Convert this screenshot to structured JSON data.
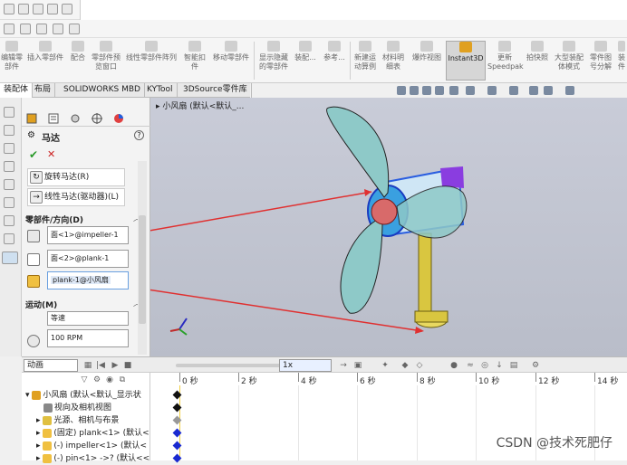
{
  "command_manager": {
    "buttons": [
      {
        "label": "编辑零\n部件"
      },
      {
        "label": "插入零部件"
      },
      {
        "label": "配合"
      },
      {
        "label": "零部件预\n览窗口"
      },
      {
        "label": "线性零部件阵列"
      },
      {
        "label": "智能扣\n件"
      },
      {
        "label": "移动零部件"
      },
      {
        "label": "显示隐藏\n的零部件"
      },
      {
        "label": "装配..."
      },
      {
        "label": "参考..."
      },
      {
        "label": "新建运\n动算例"
      },
      {
        "label": "材料明\n细表"
      },
      {
        "label": "爆炸视图"
      },
      {
        "label": "Instant3D"
      },
      {
        "label": "更新\nSpeedpak"
      },
      {
        "label": "拍快照"
      },
      {
        "label": "大型装配\n体模式"
      },
      {
        "label": "零件图\n号分解"
      },
      {
        "label": "装\n件"
      }
    ]
  },
  "tabs": [
    "装配体",
    "布局",
    "SOLIDWORKS MBD",
    "KYTool",
    "3DSource零件库"
  ],
  "viewport": {
    "tree_header": "小风扇 (默认<默认_..."
  },
  "property_manager": {
    "title": "马达",
    "help": "?",
    "ok": "✔",
    "cancel": "✕",
    "motor_types": [
      {
        "label": "旋转马达(R)"
      },
      {
        "label": "线性马达(驱动器)(L)"
      }
    ],
    "section_component": "零部件/方向(D)",
    "face1": "面<1>@impeller-1",
    "face2": "面<2>@plank-1",
    "ref": "plank-1@小风扇",
    "section_motion": "运动(M)",
    "motion_type": "等速",
    "speed": "100 RPM"
  },
  "motion_bar": {
    "study_type": "动画",
    "speed_multiplier": "1x"
  },
  "timeline": {
    "ticks": [
      "0 秒",
      "2 秒",
      "4 秒",
      "6 秒",
      "8 秒",
      "10 秒",
      "12 秒",
      "14 秒"
    ],
    "tree": [
      {
        "label": "小风扇 (默认<默认_显示状"
      },
      {
        "label": "视向及相机视图"
      },
      {
        "label": "光源、相机与布景"
      },
      {
        "label": "(固定) plank<1> (默认<"
      },
      {
        "label": "(-) impeller<1> (默认<"
      },
      {
        "label": "(-) pin<1> ->? (默认<<"
      }
    ]
  },
  "watermark": "CSDN @技术死肥仔",
  "colors": {
    "blade": "#8ec9c8",
    "hub_blue": "#2a5ee0",
    "accent_red": "#e03030",
    "stand": "#d9c640"
  }
}
